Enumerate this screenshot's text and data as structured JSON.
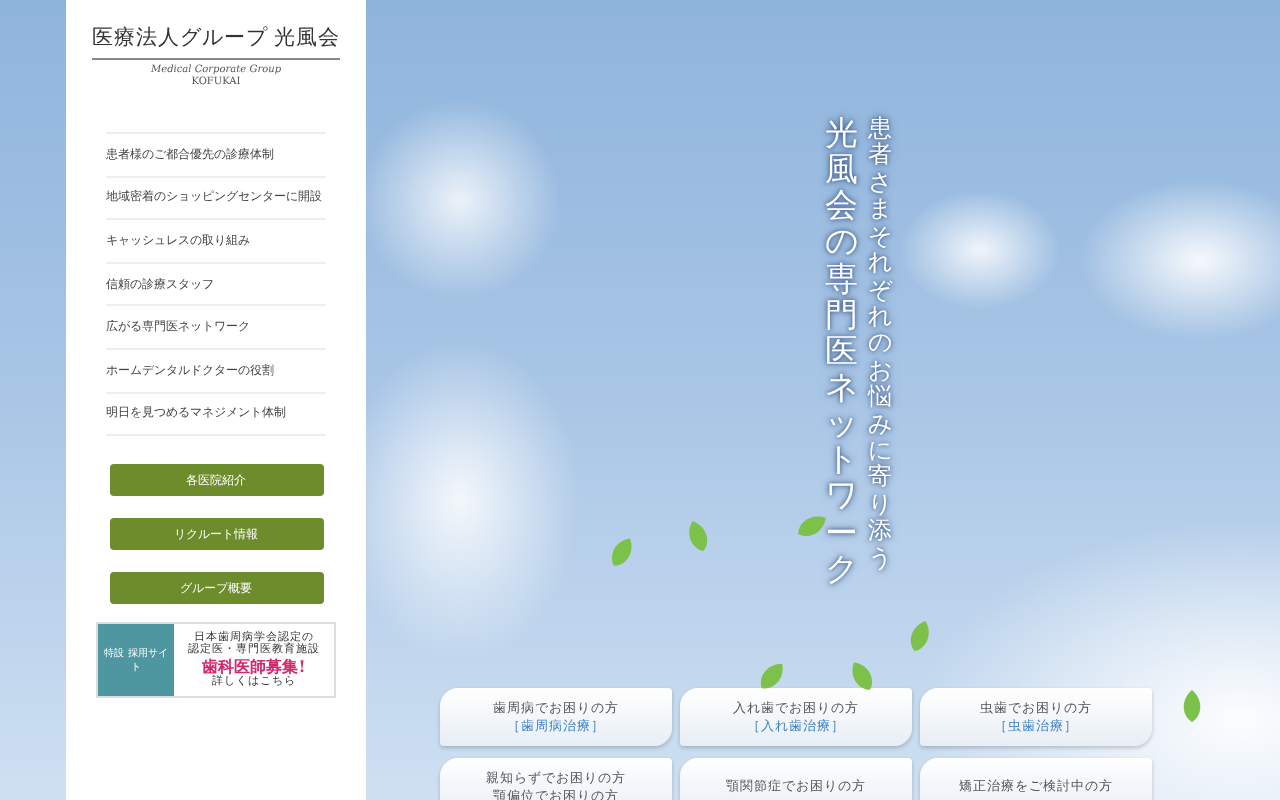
{
  "logo": {
    "title": "医療法人グループ 光風会",
    "subtitle_en": "Medical Corporate Group",
    "name_en": "KOFUKAI"
  },
  "nav": [
    "患者様のご都合優先の診療体制",
    "地域密着のショッピングセンターに開設",
    "キャッシュレスの取り組み",
    "信頼の診療スタッフ",
    "広がる専門医ネットワーク",
    "ホームデンタルドクターの役割",
    "明日を見つめるマネジメント体制"
  ],
  "buttons": [
    "各医院紹介",
    "リクルート情報",
    "グループ概要"
  ],
  "banner": {
    "tag": "特設 採用サイト",
    "line_1": "日本歯周病学会認定の",
    "line_2": "認定医・専門医教育施設",
    "headline": "歯科医師募集!",
    "link": "詳しくはこちら"
  },
  "hero": {
    "tagline": "患者さまそれぞれのお悩みに寄り添う",
    "title": "光風会の専門医ネットワーク"
  },
  "cards": [
    {
      "title": "歯周病でお困りの方",
      "subtitle": "［歯周病治療］"
    },
    {
      "title": "入れ歯でお困りの方",
      "subtitle": "［入れ歯治療］"
    },
    {
      "title": "虫歯でお困りの方",
      "subtitle": "［虫歯治療］"
    },
    {
      "title": "親知らずでお困りの方",
      "title_2": "顎偏位でお困りの方"
    },
    {
      "title": "顎関節症でお困りの方"
    },
    {
      "title": "矯正治療をご検討中の方"
    }
  ]
}
